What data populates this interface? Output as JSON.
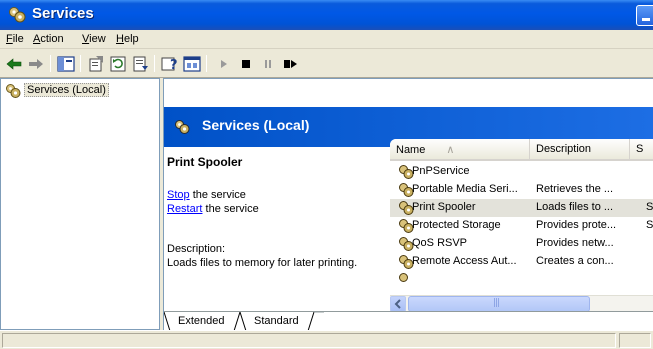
{
  "window": {
    "title": "Services",
    "colors": {
      "titlebar": "#0058e6",
      "banner": "#0051c7",
      "link": "#0000ff",
      "selected_row": "#e3e2da"
    }
  },
  "menu": {
    "items": [
      {
        "label": "File"
      },
      {
        "label": "Action"
      },
      {
        "label": "View"
      },
      {
        "label": "Help"
      }
    ]
  },
  "toolbar": {
    "buttons": [
      {
        "icon": "back-arrow-icon"
      },
      {
        "icon": "forward-arrow-icon"
      },
      {
        "icon": "show-hide-console-tree-icon"
      },
      {
        "icon": "properties-icon"
      },
      {
        "icon": "refresh-icon"
      },
      {
        "icon": "export-list-icon"
      },
      {
        "icon": "help-icon"
      },
      {
        "icon": "console-icon"
      },
      {
        "icon": "start-service-icon"
      },
      {
        "icon": "stop-service-icon"
      },
      {
        "icon": "pause-service-icon"
      },
      {
        "icon": "restart-service-icon"
      }
    ]
  },
  "tree": {
    "items": [
      {
        "label": "Services (Local)",
        "icon": "gears-icon"
      }
    ]
  },
  "header": {
    "title": "Services (Local)"
  },
  "details": {
    "service_name": "Print Spooler",
    "stop_link": "Stop",
    "stop_suffix": " the service",
    "restart_link": "Restart",
    "restart_suffix": " the service",
    "description_label": "Description:",
    "description_text": "Loads files to memory for later printing."
  },
  "list": {
    "columns": [
      {
        "label": "Name",
        "sort": "∧"
      },
      {
        "label": "Description"
      },
      {
        "label": "S"
      }
    ],
    "rows": [
      {
        "name": "PnPService",
        "description": "",
        "status": ""
      },
      {
        "name": "Portable Media Seri...",
        "description": "Retrieves the ...",
        "status": ""
      },
      {
        "name": "Print Spooler",
        "description": "Loads files to ...",
        "status": "S",
        "selected": true
      },
      {
        "name": "Protected Storage",
        "description": "Provides prote...",
        "status": "S"
      },
      {
        "name": "QoS RSVP",
        "description": "Provides netw...",
        "status": ""
      },
      {
        "name": "Remote Access Aut...",
        "description": "Creates a con...",
        "status": ""
      }
    ]
  },
  "tabs": [
    {
      "label": "Extended",
      "active": true
    },
    {
      "label": "Standard",
      "active": false
    }
  ]
}
